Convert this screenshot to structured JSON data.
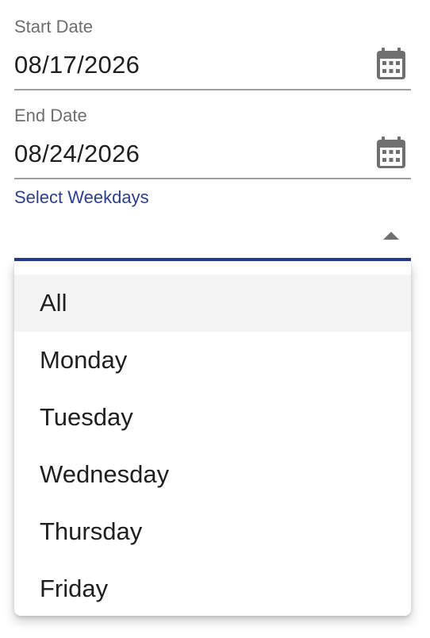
{
  "start_date": {
    "label": "Start Date",
    "value": "08/17/2026",
    "icon": "calendar-icon"
  },
  "end_date": {
    "label": "End Date",
    "value": "08/24/2026",
    "icon": "calendar-icon"
  },
  "weekdays": {
    "label": "Select Weekdays",
    "value": "",
    "expanded": true,
    "icon": "caret-up-icon",
    "accent_color": "#283a8a",
    "options": [
      "All",
      "Monday",
      "Tuesday",
      "Wednesday",
      "Thursday",
      "Friday"
    ],
    "highlighted_option": "All"
  }
}
